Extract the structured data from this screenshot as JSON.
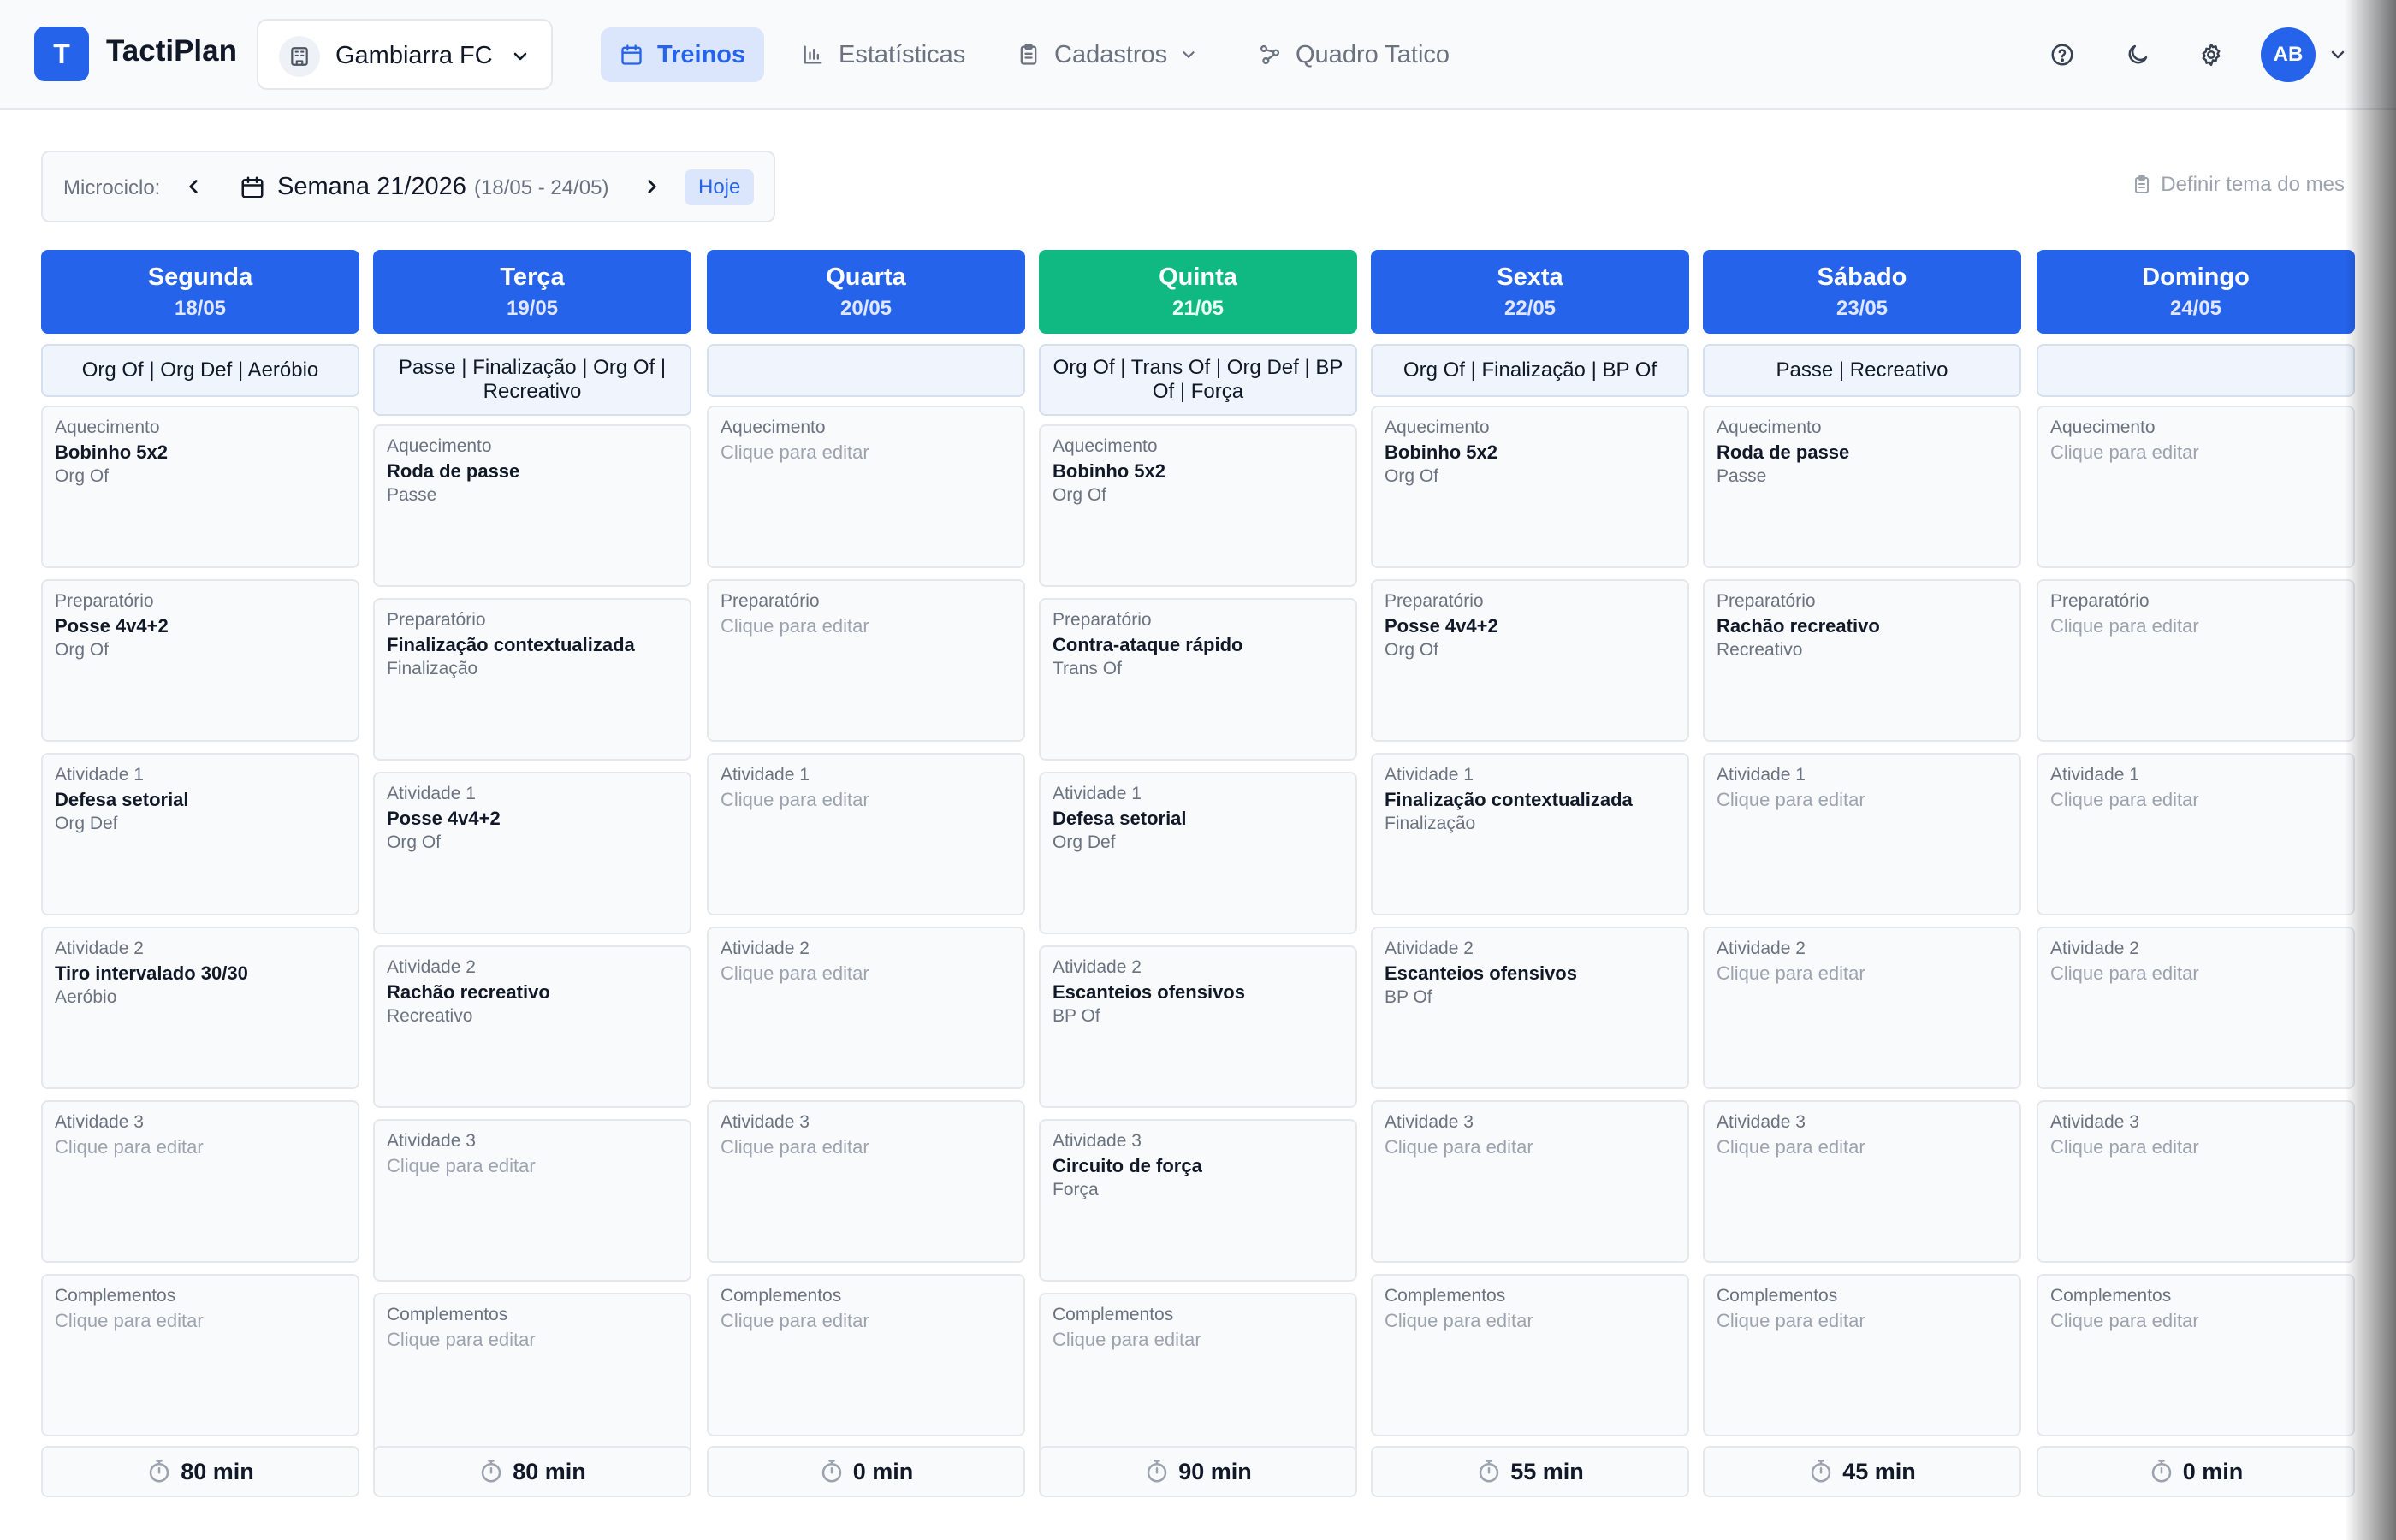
{
  "app": {
    "logo_letter": "T",
    "title": "TactiPlan"
  },
  "team": {
    "name": "Gambiarra FC"
  },
  "nav": {
    "treinos": "Treinos",
    "estatisticas": "Estatísticas",
    "cadastros": "Cadastros",
    "quadro": "Quadro Tatico"
  },
  "user": {
    "initials": "AB"
  },
  "micro": {
    "label": "Microciclo:",
    "week": "Semana 21/2026",
    "range": "(18/05 - 24/05)",
    "today_button": "Hoje",
    "theme_link": "Definir tema do mes"
  },
  "colors": {
    "primary": "#2563eb",
    "today": "#10b981"
  },
  "days": [
    {
      "name": "Segunda",
      "date": "18/05",
      "today": false,
      "theme": "Org Of | Org Def | Aeróbio",
      "total": "80 min",
      "slots": [
        {
          "label": "Aquecimento",
          "title": "Bobinho 5x2",
          "tag": "Org Of"
        },
        {
          "label": "Preparatório",
          "title": "Posse 4v4+2",
          "tag": "Org Of"
        },
        {
          "label": "Atividade 1",
          "title": "Defesa setorial",
          "tag": "Org Def"
        },
        {
          "label": "Atividade 2",
          "title": "Tiro intervalado 30/30",
          "tag": "Aeróbio"
        },
        {
          "label": "Atividade 3",
          "empty": "Clique para editar"
        },
        {
          "label": "Complementos",
          "empty": "Clique para editar"
        }
      ]
    },
    {
      "name": "Terça",
      "date": "19/05",
      "today": false,
      "theme": "Passe | Finalização | Org Of | Recreativo",
      "total": "80 min",
      "slots": [
        {
          "label": "Aquecimento",
          "title": "Roda de passe",
          "tag": "Passe"
        },
        {
          "label": "Preparatório",
          "title": "Finalização contextualizada",
          "tag": "Finalização"
        },
        {
          "label": "Atividade 1",
          "title": "Posse 4v4+2",
          "tag": "Org Of"
        },
        {
          "label": "Atividade 2",
          "title": "Rachão recreativo",
          "tag": "Recreativo"
        },
        {
          "label": "Atividade 3",
          "empty": "Clique para editar"
        },
        {
          "label": "Complementos",
          "empty": "Clique para editar"
        }
      ]
    },
    {
      "name": "Quarta",
      "date": "20/05",
      "today": false,
      "theme": "",
      "total": "0 min",
      "slots": [
        {
          "label": "Aquecimento",
          "empty": "Clique para editar"
        },
        {
          "label": "Preparatório",
          "empty": "Clique para editar"
        },
        {
          "label": "Atividade 1",
          "empty": "Clique para editar"
        },
        {
          "label": "Atividade 2",
          "empty": "Clique para editar"
        },
        {
          "label": "Atividade 3",
          "empty": "Clique para editar"
        },
        {
          "label": "Complementos",
          "empty": "Clique para editar"
        }
      ]
    },
    {
      "name": "Quinta",
      "date": "21/05",
      "today": true,
      "theme": "Org Of | Trans Of | Org Def | BP Of | Força",
      "total": "90 min",
      "slots": [
        {
          "label": "Aquecimento",
          "title": "Bobinho 5x2",
          "tag": "Org Of"
        },
        {
          "label": "Preparatório",
          "title": "Contra-ataque rápido",
          "tag": "Trans Of"
        },
        {
          "label": "Atividade 1",
          "title": "Defesa setorial",
          "tag": "Org Def"
        },
        {
          "label": "Atividade 2",
          "title": "Escanteios ofensivos",
          "tag": "BP Of"
        },
        {
          "label": "Atividade 3",
          "title": "Circuito de força",
          "tag": "Força"
        },
        {
          "label": "Complementos",
          "empty": "Clique para editar"
        }
      ]
    },
    {
      "name": "Sexta",
      "date": "22/05",
      "today": false,
      "theme": "Org Of | Finalização | BP Of",
      "total": "55 min",
      "slots": [
        {
          "label": "Aquecimento",
          "title": "Bobinho 5x2",
          "tag": "Org Of"
        },
        {
          "label": "Preparatório",
          "title": "Posse 4v4+2",
          "tag": "Org Of"
        },
        {
          "label": "Atividade 1",
          "title": "Finalização contextualizada",
          "tag": "Finalização"
        },
        {
          "label": "Atividade 2",
          "title": "Escanteios ofensivos",
          "tag": "BP Of"
        },
        {
          "label": "Atividade 3",
          "empty": "Clique para editar"
        },
        {
          "label": "Complementos",
          "empty": "Clique para editar"
        }
      ]
    },
    {
      "name": "Sábado",
      "date": "23/05",
      "today": false,
      "theme": "Passe | Recreativo",
      "total": "45 min",
      "slots": [
        {
          "label": "Aquecimento",
          "title": "Roda de passe",
          "tag": "Passe"
        },
        {
          "label": "Preparatório",
          "title": "Rachão recreativo",
          "tag": "Recreativo"
        },
        {
          "label": "Atividade 1",
          "empty": "Clique para editar"
        },
        {
          "label": "Atividade 2",
          "empty": "Clique para editar"
        },
        {
          "label": "Atividade 3",
          "empty": "Clique para editar"
        },
        {
          "label": "Complementos",
          "empty": "Clique para editar"
        }
      ]
    },
    {
      "name": "Domingo",
      "date": "24/05",
      "today": false,
      "theme": "",
      "total": "0 min",
      "slots": [
        {
          "label": "Aquecimento",
          "empty": "Clique para editar"
        },
        {
          "label": "Preparatório",
          "empty": "Clique para editar"
        },
        {
          "label": "Atividade 1",
          "empty": "Clique para editar"
        },
        {
          "label": "Atividade 2",
          "empty": "Clique para editar"
        },
        {
          "label": "Atividade 3",
          "empty": "Clique para editar"
        },
        {
          "label": "Complementos",
          "empty": "Clique para editar"
        }
      ]
    }
  ]
}
